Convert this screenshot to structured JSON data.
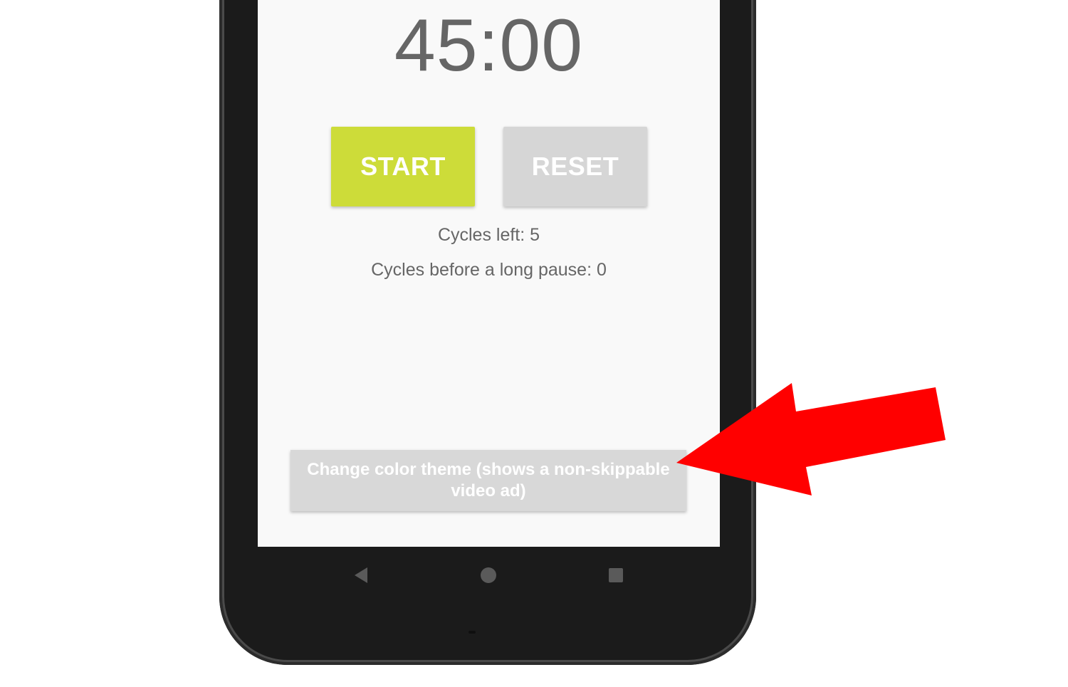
{
  "timer": {
    "display": "45:00"
  },
  "controls": {
    "start_label": "START",
    "reset_label": "RESET",
    "start_color": "#cddc39",
    "reset_color": "#d6d6d6"
  },
  "status": {
    "cycles_left": "Cycles left: 5",
    "cycles_before_long_pause": "Cycles before a long pause: 0"
  },
  "theme_button": {
    "label": "Change color theme (shows a non-skippable video ad)"
  },
  "nav": {
    "back_icon": "back-triangle-icon",
    "home_icon": "home-circle-icon",
    "recents_icon": "recents-square-icon"
  },
  "annotation": {
    "arrow_color": "#ff0000"
  }
}
